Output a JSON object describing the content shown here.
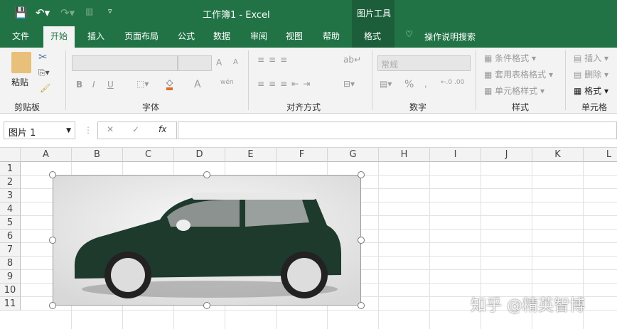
{
  "titlebar": {
    "title": "工作簿1  -  Excel",
    "context_tab": "图片工具"
  },
  "tabs": [
    "文件",
    "开始",
    "插入",
    "页面布局",
    "公式",
    "数据",
    "审阅",
    "视图",
    "帮助",
    "格式"
  ],
  "tell_me": "操作说明搜索",
  "ribbon": {
    "clipboard": {
      "paste": "粘贴",
      "label": "剪贴板"
    },
    "font": {
      "label": "字体",
      "bold": "B",
      "italic": "I",
      "underline": "U",
      "grow": "A",
      "shrink": "A",
      "font_color": "A",
      "phonetic": "wén"
    },
    "alignment": {
      "label": "对齐方式"
    },
    "number": {
      "label": "数字",
      "format": "常规",
      "percent": "%",
      "comma": ","
    },
    "styles": {
      "label": "样式",
      "conditional": "条件格式",
      "table": "套用表格格式",
      "cell": "单元格样式"
    },
    "cells": {
      "label": "单元格",
      "insert": "插入",
      "delete": "删除",
      "format": "格式"
    }
  },
  "formula_bar": {
    "name_box": "图片 1",
    "fx": "fx",
    "value": ""
  },
  "columns": [
    "A",
    "B",
    "C",
    "D",
    "E",
    "F",
    "G",
    "H",
    "I",
    "J",
    "K",
    "L"
  ],
  "rows": [
    "1",
    "2",
    "3",
    "4",
    "5",
    "6",
    "7",
    "8",
    "9",
    "10",
    "11"
  ],
  "watermark": "知乎 @精英智博",
  "colors": {
    "brand": "#217346",
    "car": "#1e3a2c"
  }
}
